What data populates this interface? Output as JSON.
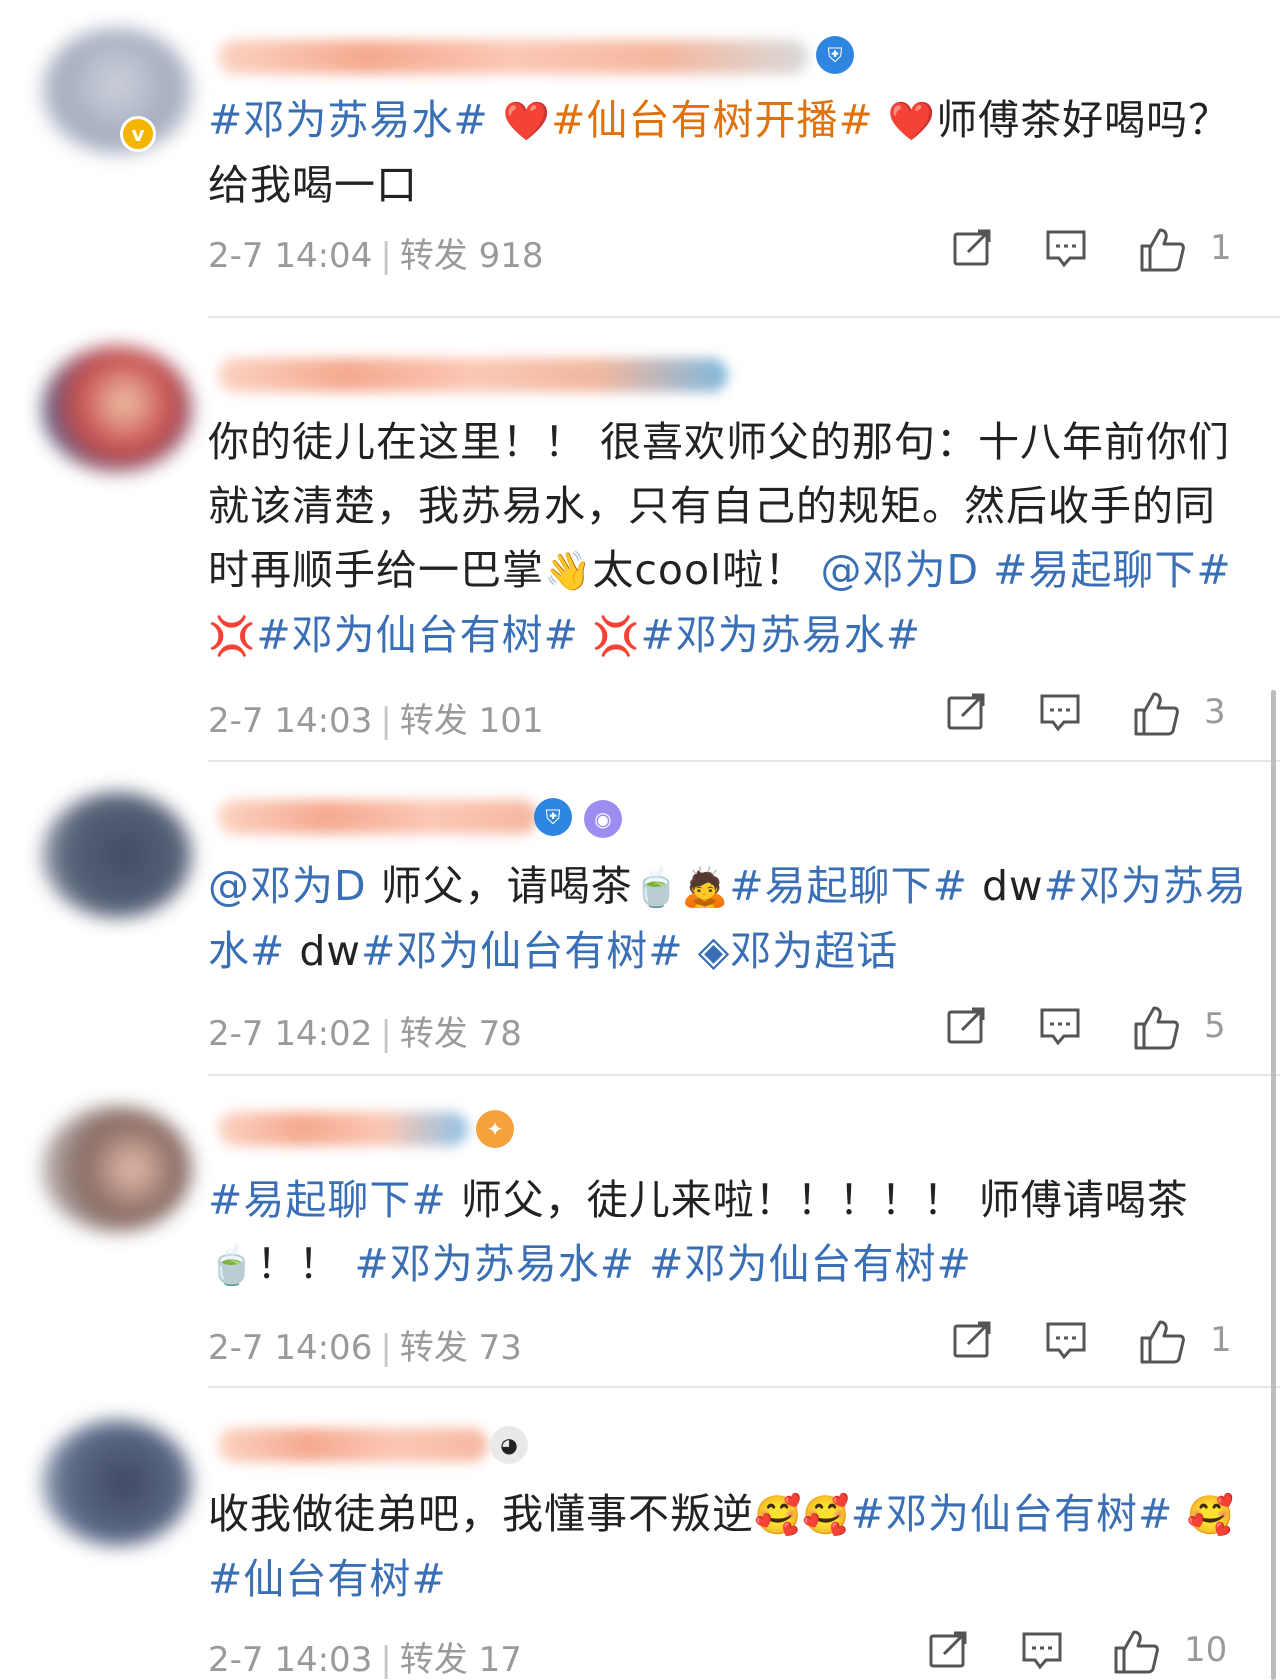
{
  "posts": [
    {
      "content": [
        {
          "t": "#邓为苏易水#",
          "c": "hl"
        },
        {
          "t": " ",
          "c": ""
        },
        {
          "t": "❤️",
          "c": "emo"
        },
        {
          "t": "#仙台有树开播#",
          "c": "hl-orange"
        },
        {
          "t": " ",
          "c": ""
        },
        {
          "t": "❤️",
          "c": "emo"
        },
        {
          "t": "师傅茶好喝吗？给我喝一口",
          "c": ""
        }
      ],
      "time": "2-7 14:04",
      "repost": "转发 918",
      "likes": "1"
    },
    {
      "content": [
        {
          "t": "你的徒儿在这里！！ 很喜欢师父的那句：十八年前你们就该清楚，我苏易水，只有自己的规矩。然后收手的同时再顺手给一巴掌",
          "c": ""
        },
        {
          "t": "👋",
          "c": "emo"
        },
        {
          "t": "太cool啦！ ",
          "c": ""
        },
        {
          "t": "@邓为D #易起聊下#",
          "c": "hl"
        },
        {
          "t": " 💢",
          "c": "emo"
        },
        {
          "t": "#邓为仙台有树#",
          "c": "hl"
        },
        {
          "t": " 💢",
          "c": "emo"
        },
        {
          "t": "#邓为苏易水#",
          "c": "hl"
        }
      ],
      "time": "2-7 14:03",
      "repost": "转发 101",
      "likes": "3"
    },
    {
      "content": [
        {
          "t": "@邓为D",
          "c": "hl"
        },
        {
          "t": " 师父，请喝茶",
          "c": ""
        },
        {
          "t": "🍵🙇",
          "c": "emo"
        },
        {
          "t": "#易起聊下#",
          "c": "hl"
        },
        {
          "t": " dw",
          "c": ""
        },
        {
          "t": "#邓为苏易水#",
          "c": "hl"
        },
        {
          "t": " dw",
          "c": ""
        },
        {
          "t": "#邓为仙台有树#",
          "c": "hl"
        },
        {
          "t": " ◈邓为超话",
          "c": "hl"
        }
      ],
      "time": "2-7 14:02",
      "repost": "转发 78",
      "likes": "5"
    },
    {
      "content": [
        {
          "t": "#易起聊下#",
          "c": "hl"
        },
        {
          "t": " 师父，徒儿来啦！！！！！ 师傅请喝茶",
          "c": ""
        },
        {
          "t": "🍵",
          "c": "emo"
        },
        {
          "t": "！！ ",
          "c": ""
        },
        {
          "t": "#邓为苏易水# #邓为仙台有树#",
          "c": "hl"
        }
      ],
      "time": "2-7 14:06",
      "repost": "转发 73",
      "likes": "1"
    },
    {
      "content": [
        {
          "t": "收我做徒弟吧，我懂事不叛逆",
          "c": ""
        },
        {
          "t": "🥰🥰",
          "c": "emo"
        },
        {
          "t": "#邓为仙台有树#",
          "c": "hl"
        },
        {
          "t": " 🥰",
          "c": "emo"
        },
        {
          "t": "#仙台有树#",
          "c": "hl"
        }
      ],
      "time": "2-7 14:03",
      "repost": "转发 17",
      "likes": "10"
    }
  ],
  "colors": {
    "link": "#3a6fb5",
    "topic_orange": "#e0720d",
    "meta": "#9a9a9a",
    "divider": "#e6e6e6"
  },
  "icons": {
    "repost": "share-icon",
    "comment": "comment-icon",
    "like": "thumbs-up-icon"
  }
}
